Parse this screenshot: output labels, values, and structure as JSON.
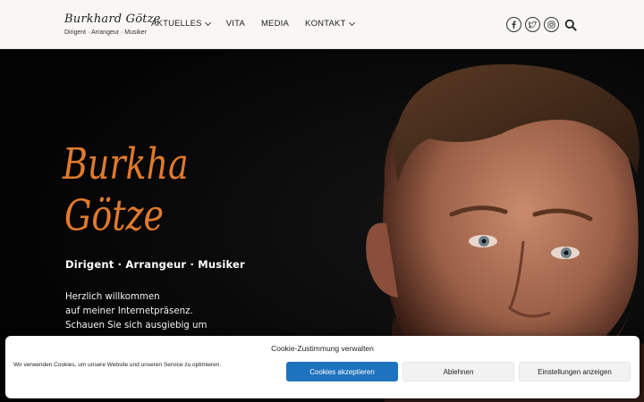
{
  "site": {
    "title": "Burkhard Götze",
    "subtitle": "Dirigent · Arrangeur · Musiker"
  },
  "nav": {
    "items": [
      {
        "label": "AKTUELLES",
        "dropdown": true
      },
      {
        "label": "VITA",
        "dropdown": false
      },
      {
        "label": "MEDIA",
        "dropdown": false
      },
      {
        "label": "KONTAKT",
        "dropdown": true
      }
    ]
  },
  "social": {
    "icons": [
      "facebook-icon",
      "twitter-icon",
      "instagram-icon"
    ]
  },
  "hero": {
    "signature_line1": "Burkhard",
    "signature_line2": "Götze",
    "tagline": "Dirigent · Arrangeur · Musiker",
    "welcome_lines": [
      "Herzlich willkommen",
      "auf meiner Internetpräsenz.",
      "Schauen Sie sich ausgiebig um"
    ],
    "accent_color": "#e07a2c"
  },
  "cookie": {
    "title": "Cookie-Zustimmung verwalten",
    "text": "Wir verwenden Cookies, um unsere Website und unseren Service zu optimieren.",
    "accept_label": "Cookies akzeptieren",
    "deny_label": "Ablehnen",
    "prefs_label": "Einstellungen anzeigen",
    "accept_color": "#1e73be"
  }
}
